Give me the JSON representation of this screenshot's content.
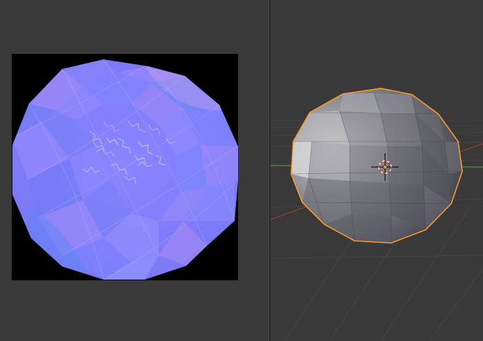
{
  "colors": {
    "editor_bg": "#393939",
    "image_border": "#000000",
    "normal_map_base": "#8080ff",
    "selection_outline": "#ff9a2e",
    "grid_line": "#4a4a4a",
    "x_axis": "#9b3b3b",
    "y_axis": "#5e8c3a",
    "cursor": "#e33d3d"
  },
  "uv_editor": {
    "image_type": "normal-map-texture"
  },
  "viewport": {
    "object": "uv-sphere",
    "selected": true,
    "cursor_icon": "3d-cursor-icon"
  }
}
